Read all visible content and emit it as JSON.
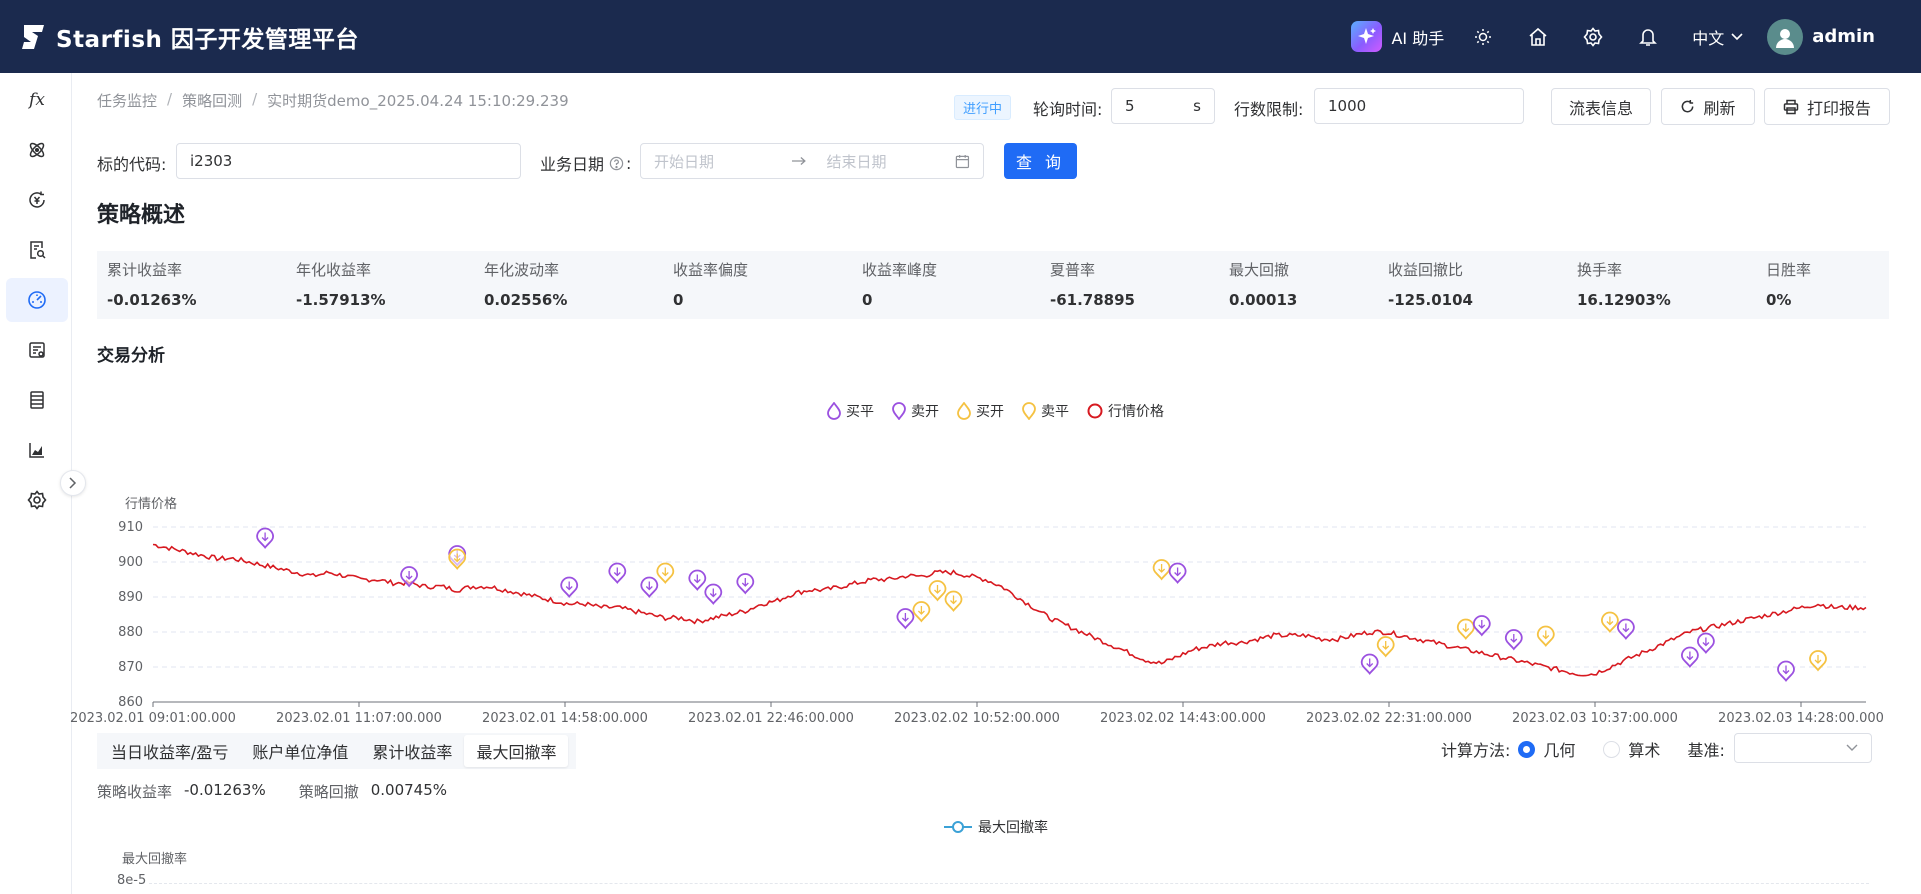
{
  "app": {
    "name": "Starfish 因子开发管理平台"
  },
  "header": {
    "ai_label": "AI 助手",
    "language": "中文",
    "username": "admin"
  },
  "breadcrumb": [
    "任务监控",
    "策略回测",
    "实时期货demo_2025.04.24 15:10:29.239"
  ],
  "toolbar": {
    "status": "进行中",
    "poll_label": "轮询时间:",
    "poll_value": "5",
    "poll_unit": "s",
    "rows_label": "行数限制:",
    "rows_value": "1000",
    "flow_btn": "流表信息",
    "refresh_btn": "刷新",
    "print_btn": "打印报告"
  },
  "filters": {
    "code_label": "标的代码:",
    "code_value": "i2303",
    "date_label": "业务日期",
    "date_start_placeholder": "开始日期",
    "date_end_placeholder": "结束日期",
    "query_btn": "查 询"
  },
  "overview": {
    "title": "策略概述",
    "metrics": [
      {
        "label": "累计收益率",
        "value": "-0.01263%"
      },
      {
        "label": "年化收益率",
        "value": "-1.57913%"
      },
      {
        "label": "年化波动率",
        "value": "0.02556%"
      },
      {
        "label": "收益率偏度",
        "value": "0"
      },
      {
        "label": "收益率峰度",
        "value": "0"
      },
      {
        "label": "夏普率",
        "value": "-61.78895"
      },
      {
        "label": "最大回撤",
        "value": "0.00013"
      },
      {
        "label": "收益回撤比",
        "value": "-125.0104"
      },
      {
        "label": "换手率",
        "value": "16.12903%"
      },
      {
        "label": "日胜率",
        "value": "0%"
      }
    ]
  },
  "trade": {
    "title": "交易分析",
    "chart_data": {
      "type": "line",
      "ylabel": "行情价格",
      "ylim": [
        860,
        910
      ],
      "yticks": [
        "910",
        "900",
        "890",
        "880",
        "870",
        "860"
      ],
      "x_tick_labels": [
        "2023.02.01 09:01:00.000",
        "2023.02.01 11:07:00.000",
        "2023.02.01 14:58:00.000",
        "2023.02.01 22:46:00.000",
        "2023.02.02 10:52:00.000",
        "2023.02.02 14:43:00.000",
        "2023.02.02 22:31:00.000",
        "2023.02.03 10:37:00.000",
        "2023.02.03 14:28:00.000"
      ],
      "legend": [
        {
          "name": "买平",
          "color": "#9b51e0",
          "icon": "pin-down-icon"
        },
        {
          "name": "卖开",
          "color": "#9b51e0",
          "icon": "pin-up-icon"
        },
        {
          "name": "买开",
          "color": "#f5c242",
          "icon": "pin-down-icon"
        },
        {
          "name": "卖平",
          "color": "#f5c242",
          "icon": "pin-up-icon"
        },
        {
          "name": "行情价格",
          "color": "#d71920",
          "icon": "circle-icon"
        }
      ],
      "series": [
        {
          "name": "行情价格",
          "color": "#d71920",
          "values": [
            905,
            904,
            903,
            902,
            901,
            901,
            900,
            899,
            898,
            897,
            896,
            897,
            896,
            895,
            895,
            894,
            894,
            893,
            893,
            892,
            893,
            893,
            892,
            891,
            890,
            889,
            888,
            888,
            887,
            887,
            886,
            885,
            884,
            884,
            883,
            884,
            885,
            886,
            888,
            889,
            891,
            892,
            892,
            893,
            894,
            895,
            895,
            896,
            896,
            897,
            897,
            896,
            895,
            893,
            890,
            887,
            884,
            882,
            880,
            878,
            876,
            874,
            872,
            871,
            873,
            875,
            876,
            877,
            877,
            878,
            879,
            879,
            879,
            878,
            878,
            879,
            880,
            880,
            879,
            878,
            877,
            876,
            875,
            874,
            873,
            872,
            871,
            870,
            869,
            868,
            868,
            870,
            872,
            874,
            876,
            878,
            880,
            881,
            882,
            883,
            884,
            885,
            886,
            887,
            888,
            887,
            887,
            887
          ]
        }
      ],
      "markers": [
        {
          "type": "卖开",
          "i": 7,
          "y": 905
        },
        {
          "type": "卖开",
          "i": 16,
          "y": 894
        },
        {
          "type": "买平",
          "i": 19,
          "y": 900
        },
        {
          "type": "卖平",
          "i": 19,
          "y": 899
        },
        {
          "type": "卖开",
          "i": 26,
          "y": 891
        },
        {
          "type": "买平",
          "i": 29,
          "y": 895
        },
        {
          "type": "卖开",
          "i": 31,
          "y": 891
        },
        {
          "type": "卖平",
          "i": 32,
          "y": 895
        },
        {
          "type": "买平",
          "i": 34,
          "y": 893
        },
        {
          "type": "卖开",
          "i": 35,
          "y": 889
        },
        {
          "type": "买平",
          "i": 37,
          "y": 892
        },
        {
          "type": "卖开",
          "i": 47,
          "y": 882
        },
        {
          "type": "买开",
          "i": 48,
          "y": 884
        },
        {
          "type": "卖平",
          "i": 49,
          "y": 890
        },
        {
          "type": "买开",
          "i": 50,
          "y": 887
        },
        {
          "type": "卖平",
          "i": 63,
          "y": 896
        },
        {
          "type": "买平",
          "i": 64,
          "y": 895
        },
        {
          "type": "卖开",
          "i": 76,
          "y": 869
        },
        {
          "type": "买开",
          "i": 77,
          "y": 874
        },
        {
          "type": "卖平",
          "i": 82,
          "y": 879
        },
        {
          "type": "买平",
          "i": 83,
          "y": 880
        },
        {
          "type": "卖开",
          "i": 85,
          "y": 876
        },
        {
          "type": "买开",
          "i": 87,
          "y": 877
        },
        {
          "type": "卖平",
          "i": 91,
          "y": 881
        },
        {
          "type": "买平",
          "i": 92,
          "y": 879
        },
        {
          "type": "卖开",
          "i": 96,
          "y": 871
        },
        {
          "type": "买平",
          "i": 97,
          "y": 875
        },
        {
          "type": "卖开",
          "i": 102,
          "y": 867
        },
        {
          "type": "买开",
          "i": 104,
          "y": 870
        }
      ]
    }
  },
  "perf_tabs": {
    "tabs": [
      "当日收益率/盈亏",
      "账户单位净值",
      "累计收益率",
      "最大回撤率"
    ],
    "active": 3,
    "calc_label": "计算方法:",
    "calc_opt1": "几何",
    "calc_opt2": "算术",
    "calc_selected": "几何",
    "bench_label": "基准:",
    "ret_label": "策略收益率",
    "ret_value": "-0.01263%",
    "dd_label": "策略回撤",
    "dd_value": "0.00745%"
  },
  "dd_chart": {
    "chart_data": {
      "type": "line",
      "ylabel": "最大回撤率",
      "legend": [
        {
          "name": "最大回撤率",
          "color": "#3ba1d6"
        }
      ],
      "yticks": [
        "8e-5"
      ]
    }
  }
}
